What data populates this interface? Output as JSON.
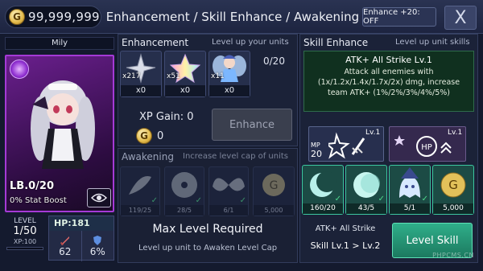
{
  "header": {
    "gold": "99,999,999",
    "gold_icon": "G",
    "title": "Enhancement / Skill Enhance / Awakening",
    "enhance20_label": "Enhance +20: OFF",
    "close_label": "X"
  },
  "unit": {
    "name": "Mily",
    "limit_break": "LB.0/20",
    "stat_boost": "0% Stat Boost",
    "level_label": "LEVEL",
    "level_value": "1/50",
    "xp_label": "XP:100",
    "hp_label": "HP:181",
    "atk": "62",
    "def": "6%"
  },
  "enhancement": {
    "title": "Enhancement",
    "subtitle": "Level up your units",
    "count": "0/20",
    "materials": [
      {
        "icon": "silver-star-icon",
        "count": "x217",
        "used": "x0"
      },
      {
        "icon": "rainbow-star-icon",
        "count": "x51",
        "used": "x0"
      },
      {
        "icon": "fairy-icon",
        "count": "x11",
        "used": "x0"
      }
    ],
    "xp_gain": "XP Gain: 0",
    "gold_cost": "0",
    "button": "Enhance"
  },
  "awakening": {
    "title": "Awakening",
    "subtitle": "Increase level cap of units",
    "slots": [
      {
        "icon": "feather-icon",
        "count": "119/25"
      },
      {
        "icon": "disc-icon",
        "count": "28/5"
      },
      {
        "icon": "wings-icon",
        "count": "6/1"
      },
      {
        "icon": "gold-coin-icon",
        "count": "5,000"
      }
    ],
    "requirement": "Max Level Required",
    "hint": "Level up unit to Awaken Level Cap"
  },
  "skill": {
    "title": "Skill Enhance",
    "subtitle": "Level up unit skills",
    "skill_name": "ATK+ All Strike Lv.1",
    "skill_desc": "Attack all enemies with (1x/1.2x/1.4x/1.7x/2x) dmg, increase team ATK+ (1%/2%/3%/4%/5%)",
    "active_mp": "MP",
    "active_mp_value": "20",
    "active_lv": "Lv.1",
    "passive_lv": "Lv.1",
    "slots": [
      {
        "icon": "crescent-moon-icon",
        "count": "160/20"
      },
      {
        "icon": "full-moon-icon",
        "count": "43/5"
      },
      {
        "icon": "witch-ghost-icon",
        "count": "5/1"
      },
      {
        "icon": "gold-coin-icon",
        "count": "5,000"
      }
    ],
    "footer_name": "ATK+ All Strike",
    "footer_level": "Skill Lv.1 > Lv.2",
    "button": "Level Skill"
  },
  "watermark": "PHPCMS.CN"
}
